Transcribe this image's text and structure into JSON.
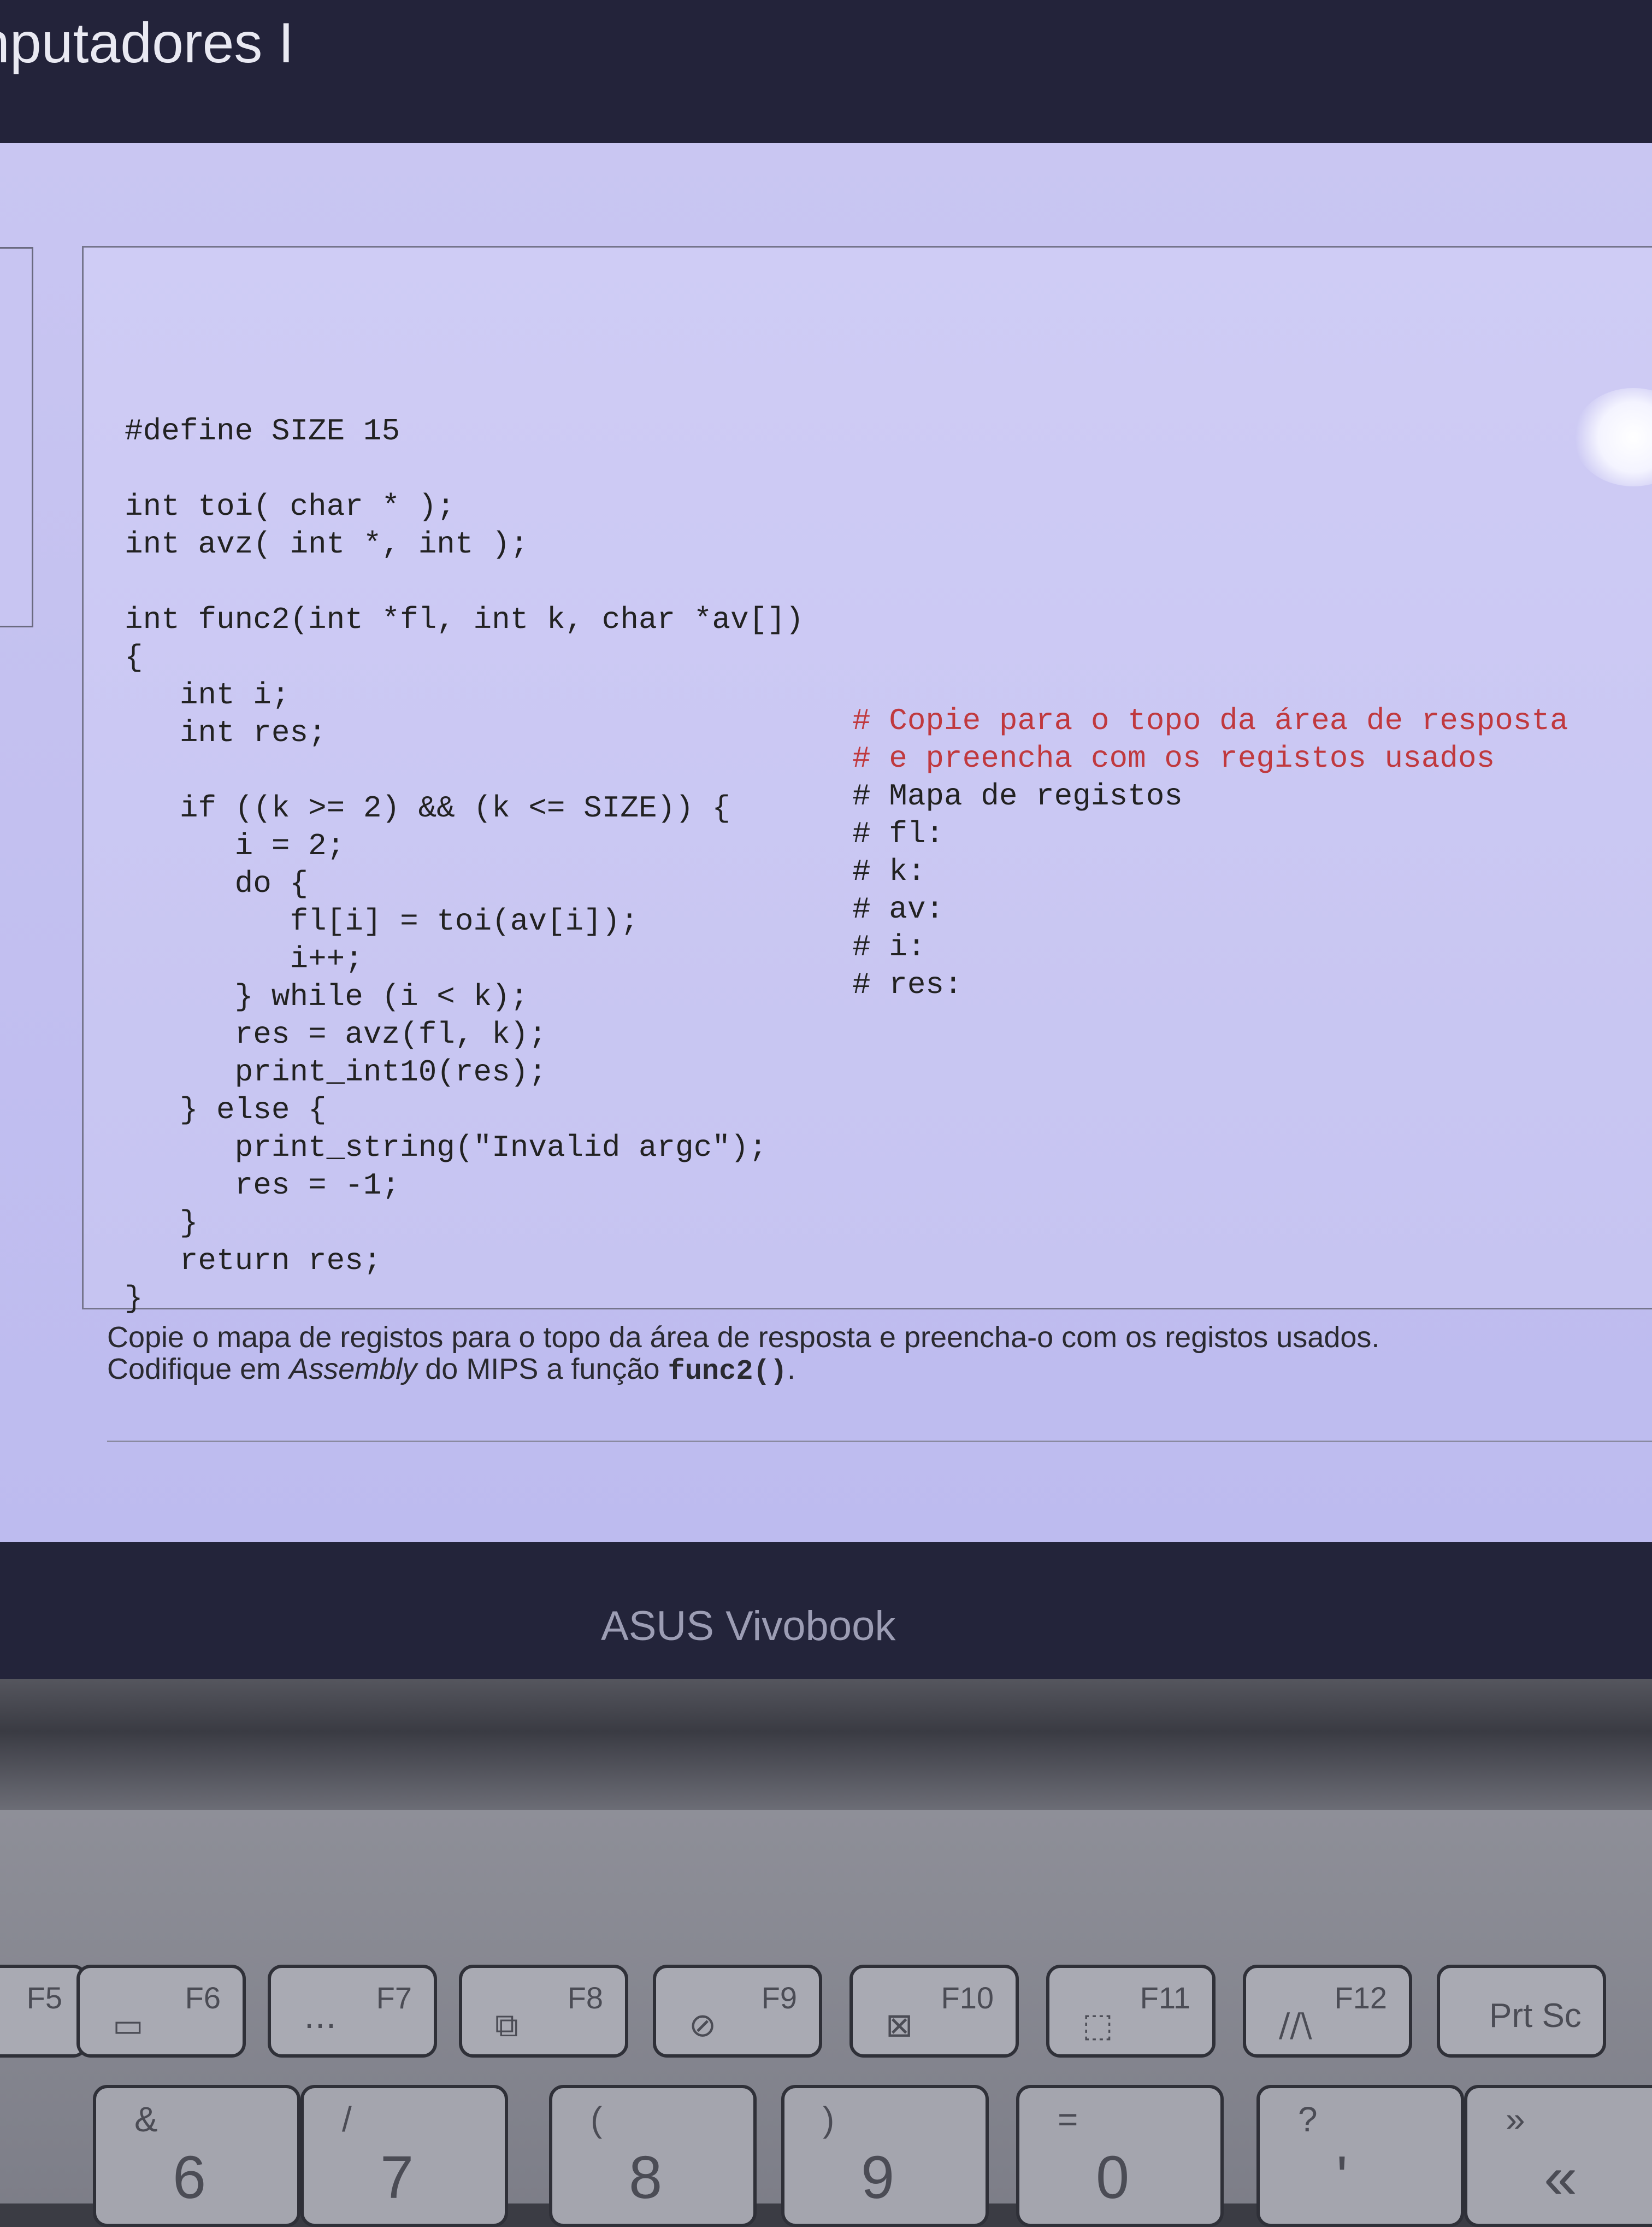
{
  "window": {
    "title": "nputadores I"
  },
  "code": {
    "main_lines": [
      "#define SIZE 15",
      "",
      "int toi( char * );",
      "int avz( int *, int );",
      "",
      "int func2(int *fl, int k, char *av[])",
      "{",
      "   int i;",
      "   int res;",
      "",
      "   if ((k >= 2) && (k <= SIZE)) {",
      "      i = 2;",
      "      do {",
      "         fl[i] = toi(av[i]);",
      "         i++;",
      "      } while (i < k);",
      "      res = avz(fl, k);",
      "      print_int10(res);",
      "   } else {",
      "      print_string(\"Invalid argc\");",
      "      res = -1;",
      "   }",
      "   return res;",
      "}"
    ],
    "comment_lines": [
      {
        "text": "# Copie para o topo da área de resposta",
        "highlight": true
      },
      {
        "text": "# e preencha com os registos usados",
        "highlight": true
      },
      {
        "text": "# Mapa de registos",
        "highlight": false
      },
      {
        "text": "# fl:",
        "highlight": false
      },
      {
        "text": "# k:",
        "highlight": false
      },
      {
        "text": "# av:",
        "highlight": false
      },
      {
        "text": "# i:",
        "highlight": false
      },
      {
        "text": "# res:",
        "highlight": false
      }
    ]
  },
  "description": {
    "line1": "Copie o mapa de registos para o topo da área de resposta e preencha-o com os registos usados.",
    "line2_a": "Codifique em ",
    "line2_em": "Assembly",
    "line2_b": " do MIPS a função ",
    "line2_code": "func2()",
    "line2_c": "."
  },
  "bezel": {
    "brand": "ASUS Vivobook"
  },
  "keyboard": {
    "fkeys": [
      {
        "label": "F5",
        "icon": ""
      },
      {
        "label": "F6",
        "icon": "▭"
      },
      {
        "label": "F7",
        "icon": "⋯"
      },
      {
        "label": "F8",
        "icon": "⧉"
      },
      {
        "label": "F9",
        "icon": "⊘"
      },
      {
        "label": "F10",
        "icon": "⊠"
      },
      {
        "label": "F11",
        "icon": "⬚"
      },
      {
        "label": "F12",
        "icon": "//\\"
      },
      {
        "label": "Prt Sc",
        "icon": ""
      }
    ],
    "number_keys": [
      {
        "symbol": "&",
        "num": "6"
      },
      {
        "symbol": "/",
        "num": "7"
      },
      {
        "symbol": "(",
        "num": "8"
      },
      {
        "symbol": ")",
        "num": "9"
      },
      {
        "symbol": "=",
        "num": "0"
      },
      {
        "symbol": "?",
        "num": "'"
      },
      {
        "symbol": "»",
        "num": "«"
      }
    ]
  },
  "colors": {
    "screen_bg": "#c6c4f1",
    "comment_red": "#c0393e",
    "titlebar": "#23233a"
  }
}
